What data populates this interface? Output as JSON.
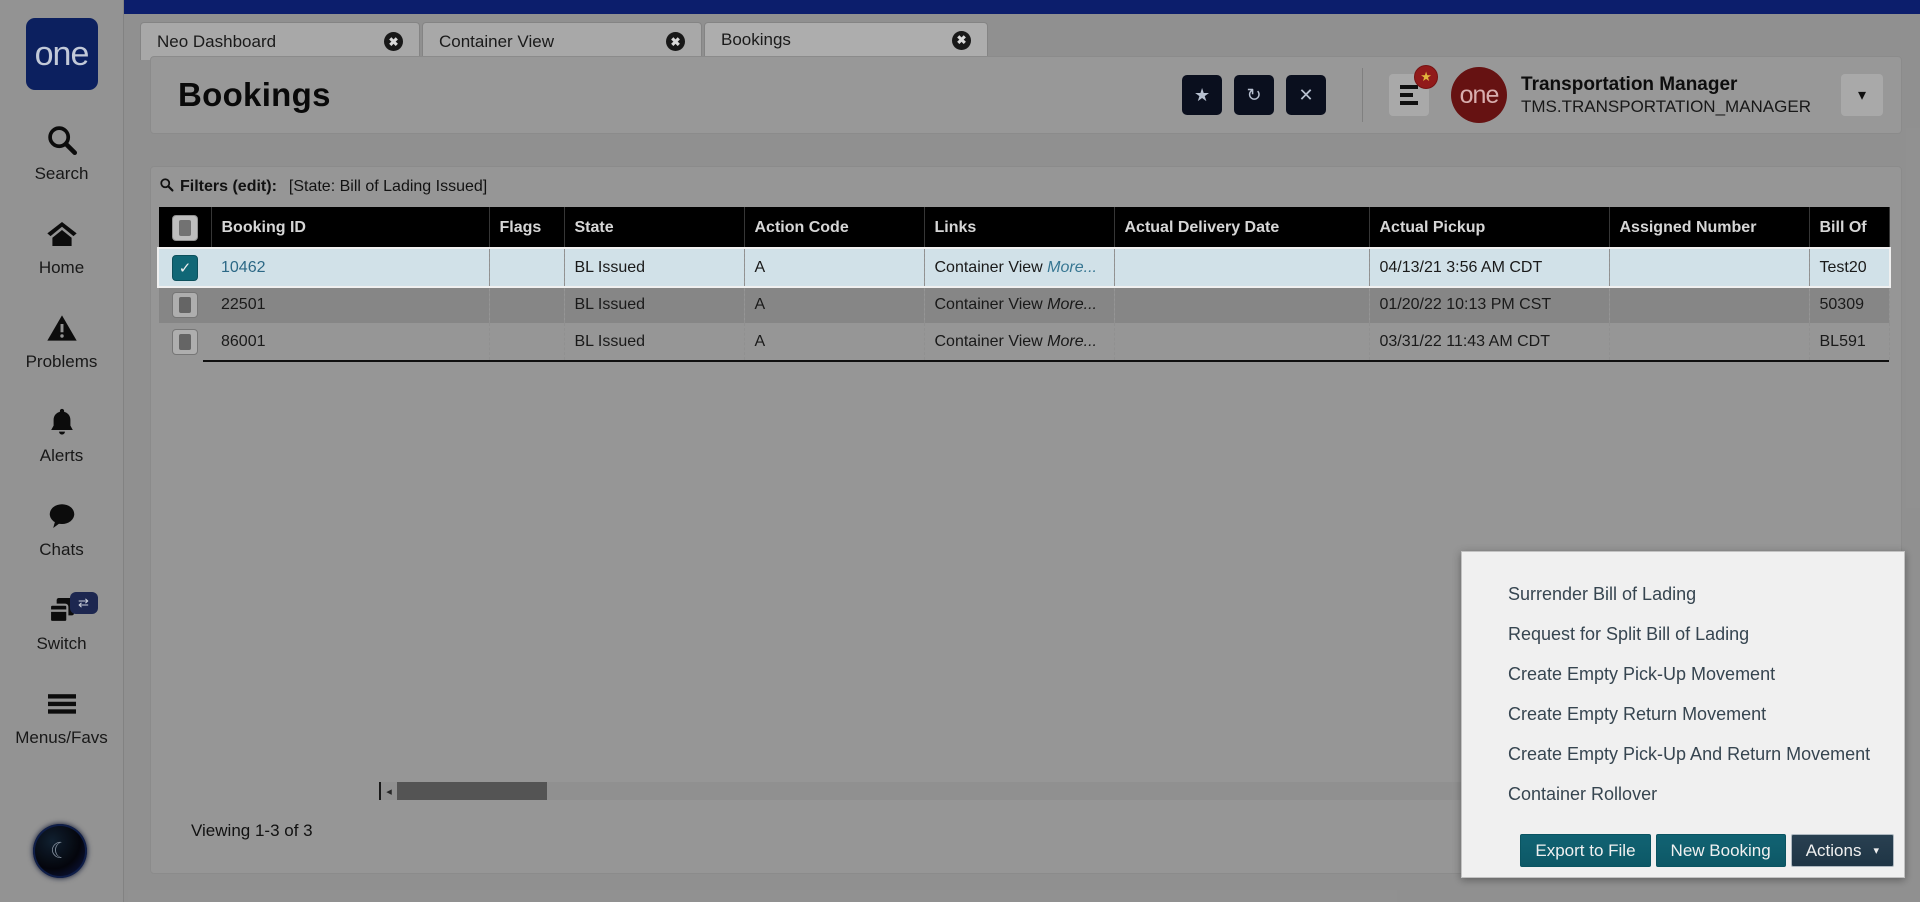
{
  "brand": {
    "logo_text": "one",
    "accent_navy": "#0d2265",
    "accent_teal": "#126e7e",
    "topbar_blue": "#0d2073"
  },
  "rail": {
    "items": [
      {
        "label": "Search",
        "icon": "search-icon"
      },
      {
        "label": "Home",
        "icon": "home-icon"
      },
      {
        "label": "Problems",
        "icon": "warning-triangle-icon"
      },
      {
        "label": "Alerts",
        "icon": "bell-icon"
      },
      {
        "label": "Chats",
        "icon": "chat-bubble-icon"
      },
      {
        "label": "Switch",
        "icon": "switch-windows-icon",
        "badge_icon": "swap-arrows-icon"
      },
      {
        "label": "Menus/Favs",
        "icon": "hamburger-icon"
      }
    ]
  },
  "tabs": [
    {
      "label": "Neo Dashboard",
      "active": false,
      "close": "✖"
    },
    {
      "label": "Container View",
      "active": false,
      "close": "✖"
    },
    {
      "label": "Bookings",
      "active": true,
      "close": "✖"
    }
  ],
  "header": {
    "title": "Bookings",
    "icon_buttons": [
      {
        "name": "favorite-star-button",
        "glyph": "★"
      },
      {
        "name": "refresh-button",
        "glyph": "↻"
      },
      {
        "name": "close-button",
        "glyph": "✕"
      }
    ],
    "menu_button_badge": "★",
    "user_name": "Transportation Manager",
    "user_id": "TMS.TRANSPORTATION_MANAGER",
    "avatar_text": "one",
    "caret": "▾"
  },
  "filters": {
    "magnifier": "⚲",
    "label": "Filters (edit):",
    "value": "[State: Bill of Lading Issued]"
  },
  "table": {
    "columns": [
      "Booking ID",
      "Flags",
      "State",
      "Action Code",
      "Links",
      "Actual Delivery Date",
      "Actual Pickup",
      "Assigned Number",
      "Bill Of"
    ],
    "rows": [
      {
        "selected": true,
        "booking_id": "10462",
        "flags": "",
        "state": "BL Issued",
        "action_code": "A",
        "links_main": "Container View",
        "links_more": "More...",
        "actual_delivery_date": "",
        "actual_pickup": "04/13/21 3:56 AM CDT",
        "assigned_number": "",
        "bill_of": "Test20"
      },
      {
        "selected": false,
        "booking_id": "22501",
        "flags": "",
        "state": "BL Issued",
        "action_code": "A",
        "links_main": "Container View",
        "links_more": "More...",
        "actual_delivery_date": "",
        "actual_pickup": "01/20/22 10:13 PM CST",
        "assigned_number": "",
        "bill_of": "50309"
      },
      {
        "selected": false,
        "booking_id": "86001",
        "flags": "",
        "state": "BL Issued",
        "action_code": "A",
        "links_main": "Container View",
        "links_more": "More...",
        "actual_delivery_date": "",
        "actual_pickup": "03/31/22 11:43 AM CDT",
        "assigned_number": "",
        "bill_of": "BL591"
      }
    ]
  },
  "footer": {
    "viewing": "Viewing 1-3 of 3"
  },
  "scrollbar": {
    "left_arrow": "◂"
  },
  "actions_menu": {
    "items": [
      "Surrender Bill of Lading",
      "Request for Split Bill of Lading",
      "Create Empty Pick-Up Movement",
      "Create Empty Return Movement",
      "Create Empty Pick-Up And Return Movement",
      "Container Rollover"
    ],
    "buttons": {
      "export": "Export to File",
      "new_booking": "New Booking",
      "actions": "Actions",
      "actions_caret": "▾"
    }
  }
}
